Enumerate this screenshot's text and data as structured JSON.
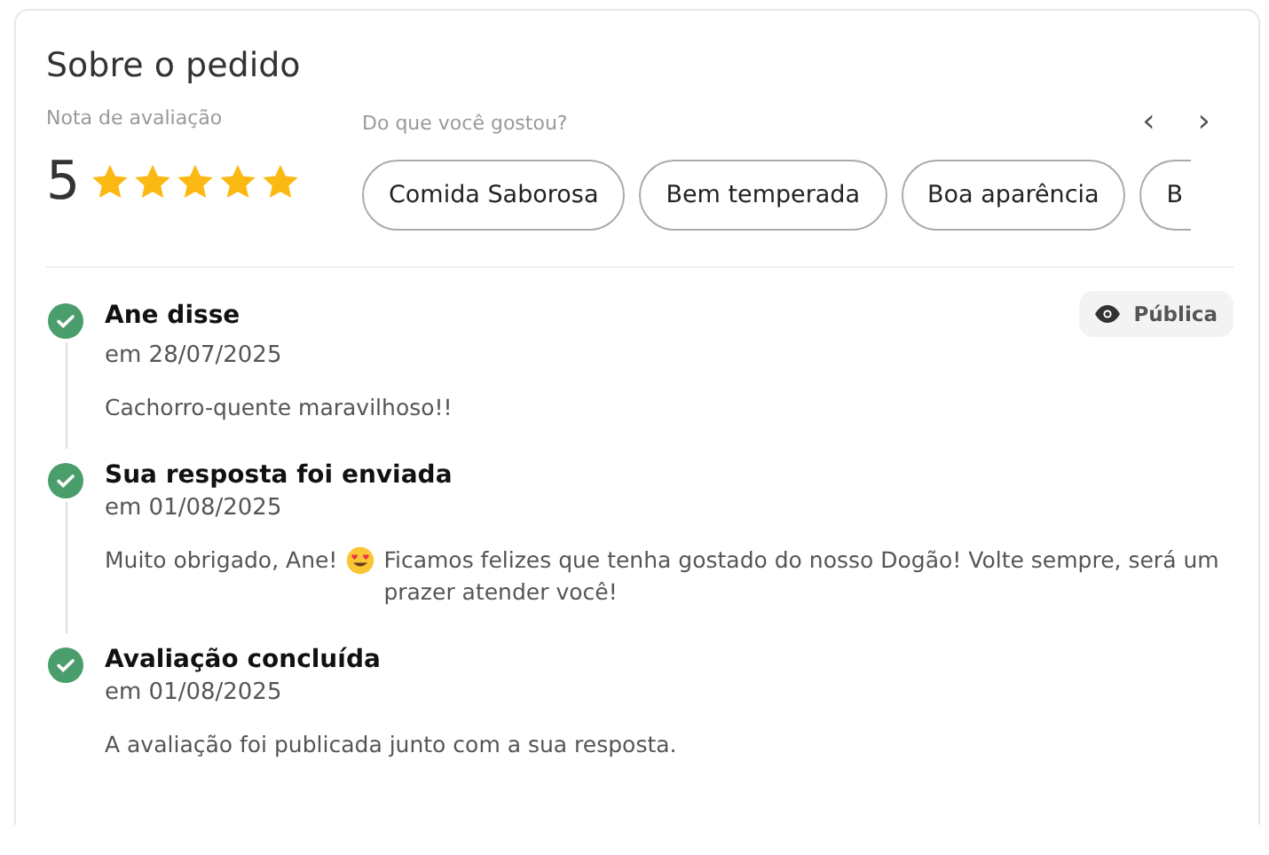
{
  "section": {
    "title": "Sobre o pedido"
  },
  "rating": {
    "label": "Nota de avaliação",
    "value": "5",
    "stars": 5
  },
  "likes": {
    "label": "Do que você gostou?",
    "prev": "‹",
    "next": "›",
    "chips": [
      "Comida Saborosa",
      "Bem temperada",
      "Boa aparência",
      "B"
    ]
  },
  "timeline": [
    {
      "title": "Ane disse",
      "date": "em 28/07/2025",
      "done": true,
      "badge": {
        "label": "Pública"
      },
      "message": [
        {
          "kind": "text",
          "text": "Cachorro-quente maravilhoso!!"
        }
      ]
    },
    {
      "title": "Sua resposta foi enviada",
      "date": "em 01/08/2025",
      "done": true,
      "message": [
        {
          "kind": "text",
          "text": "Muito obrigado, Ane!"
        },
        {
          "kind": "emoji"
        },
        {
          "kind": "text",
          "text": "Ficamos felizes que tenha gostado do nosso Dogão! Volte sempre, será um prazer atender você!"
        }
      ]
    },
    {
      "title": "Avaliação concluída",
      "date": "em 01/08/2025",
      "done": true,
      "message": [
        {
          "kind": "text",
          "text": "A avaliação foi publicada junto com a sua resposta."
        }
      ]
    }
  ]
}
